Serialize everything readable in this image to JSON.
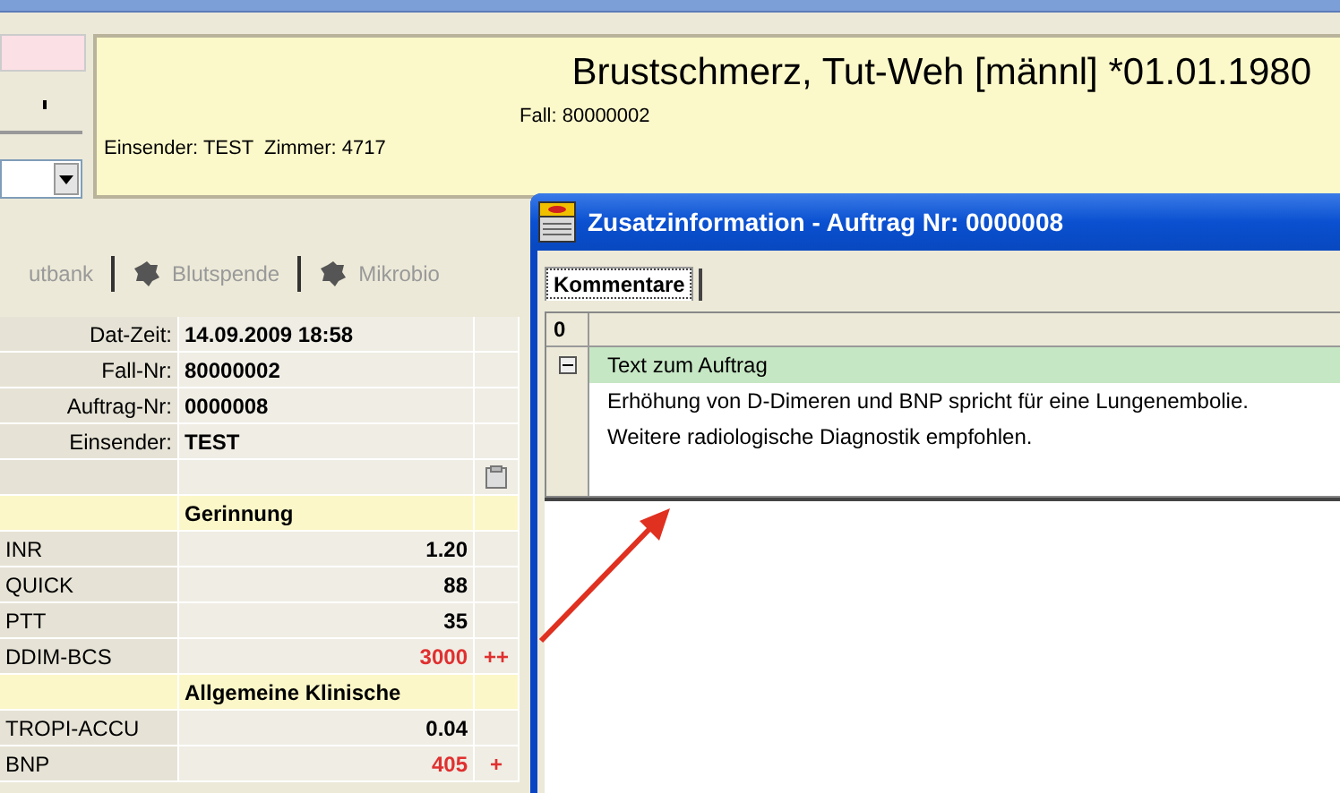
{
  "header": {
    "patient": "Brustschmerz, Tut-Weh [männl] *01.01.1980",
    "case": "Fall: 80000002",
    "sender": "Einsender: TEST  Zimmer: 4717"
  },
  "tabs": [
    {
      "label": "utbank",
      "icon": false,
      "disabled": true
    },
    {
      "label": "Blutspende",
      "icon": true,
      "disabled": true
    },
    {
      "label": "Mikrobio",
      "icon": true,
      "disabled": true
    }
  ],
  "info_rows": [
    {
      "label": "Dat-Zeit:",
      "value": "14.09.2009 18:58"
    },
    {
      "label": "Fall-Nr:",
      "value": "80000002"
    },
    {
      "label": "Auftrag-Nr:",
      "value": "0000008"
    },
    {
      "label": "Einsender:",
      "value": "TEST"
    }
  ],
  "results": [
    {
      "kind": "section",
      "title": "Gerinnung"
    },
    {
      "kind": "result",
      "name": "INR",
      "value": "1.20",
      "abnormal": false
    },
    {
      "kind": "result",
      "name": "QUICK",
      "value": "88",
      "abnormal": false
    },
    {
      "kind": "result",
      "name": "PTT",
      "value": "35",
      "abnormal": false
    },
    {
      "kind": "result",
      "name": "DDIM-BCS",
      "value": "3000",
      "flag": "++",
      "abnormal": true
    },
    {
      "kind": "section",
      "title": "Allgemeine Klinische"
    },
    {
      "kind": "result",
      "name": "TROPI-ACCU",
      "value": "0.04",
      "abnormal": false
    },
    {
      "kind": "result",
      "name": "BNP",
      "value": "405",
      "flag": "+",
      "abnormal": true
    }
  ],
  "dialog": {
    "title": "Zusatzinformation - Auftrag Nr: 0000008",
    "tabs": [
      {
        "label": "Kommentare",
        "selected": true
      }
    ],
    "grid": {
      "header": "0",
      "group": {
        "title": "Text zum Auftrag",
        "expanded": true,
        "lines": [
          "Erhöhung von D-Dimeren und BNP spricht für eine Lungenembolie.",
          "Weitere radiologische Diagnostik empfohlen."
        ]
      }
    }
  }
}
